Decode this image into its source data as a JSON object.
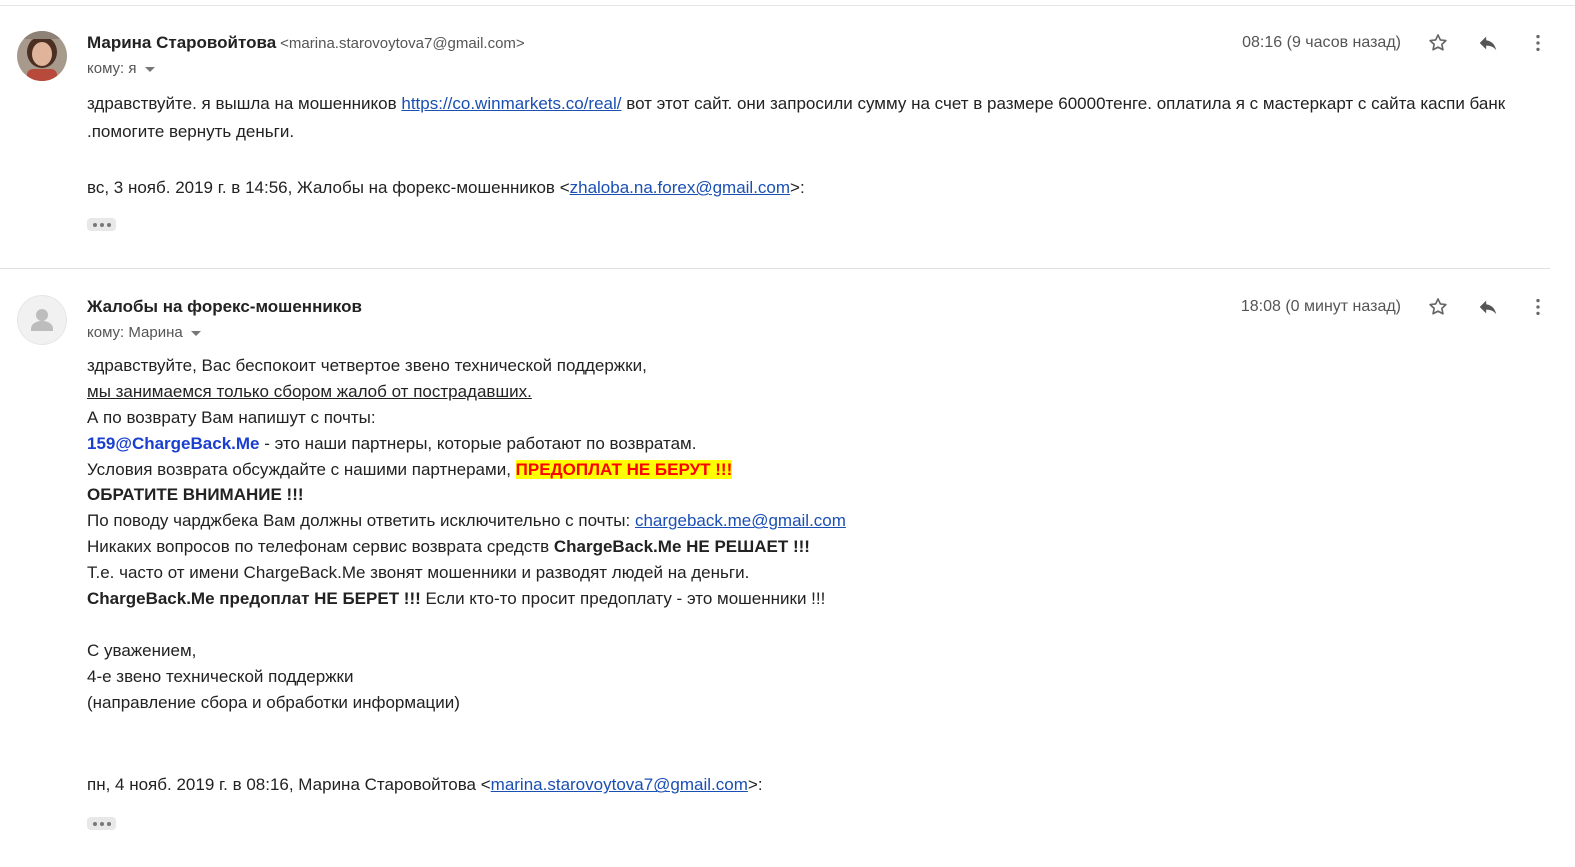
{
  "messages": [
    {
      "sender_name": "Марина Старовойтова",
      "sender_email": "<marina.starovoytova7@gmail.com>",
      "to": "кому: я",
      "time": "08:16 (9 часов назад)",
      "body_pre": "здравствуйте. я вышла на мошенников  ",
      "body_link": "https://co.winmarkets.co/real/",
      "body_post": " вот этот сайт. они запросили сумму на счет в размере 60000тенге. оплатила я с мастеркарт с сайта каспи банк .помогите вернуть деньги.",
      "quote_pre": "вс, 3 нояб. 2019 г. в 14:56, Жалобы на форекс-мошенников <",
      "quote_link": "zhaloba.na.forex@gmail.com",
      "quote_post": ">:"
    },
    {
      "sender_name": "Жалобы на форекс-мошенников",
      "to": "кому: Марина",
      "time": "18:08 (0 минут назад)",
      "lines": {
        "l1": "здравствуйте, Вас беспокоит четвертое звено технической поддержки,",
        "l2": "мы занимаемся только сбором жалоб от пострадавших.",
        "l3": "А по возврату Вам напишут с почты:",
        "l4_email": "159@ChargeBack.Me",
        "l4_rest": " - это наши партнеры, которые работают по возвратам.",
        "l5_pre": "Условия возврата обсуждайте с нашими партнерами, ",
        "l5_hl": "ПРЕДОПЛАТ НЕ БЕРУТ !!!",
        "l6": "ОБРАТИТЕ ВНИМАНИЕ !!!",
        "l7_pre": "По поводу чарджбека Вам должны ответить исключительно с почты: ",
        "l7_link": "chargeback.me@gmail.com",
        "l8_pre": "Никаких вопросов по телефонам сервис возврата средств ",
        "l8_bold": "ChargeBack.Me НЕ РЕШАЕТ !!!",
        "l9": "Т.е. часто от имени ChargeBack.Me звонят мошенники и разводят людей на деньги.",
        "l10_bold": "ChargeBack.Me предоплат НЕ БЕРЕТ !!!",
        "l10_rest": " Если кто-то просит предоплату - это мошенники !!!",
        "sig1": "С уважением,",
        "sig2": "4-е звено технической поддержки",
        "sig3": "(направление сбора и обработки информации)"
      },
      "quote_pre": "пн, 4 нояб. 2019 г. в 08:16, Марина Старовойтова <",
      "quote_link": "marina.starovoytova7@gmail.com",
      "quote_post": ">:"
    }
  ],
  "icons": {
    "star": "star-icon",
    "reply": "reply-icon",
    "more": "more-vert-icon",
    "expand": "more-horiz-icon",
    "default_avatar": "person-icon"
  },
  "colors": {
    "link": "#1a4fb3",
    "highlight_bg": "#ffff00",
    "highlight_text": "#ff0000",
    "email_bold_blue": "#1a3fcf"
  }
}
